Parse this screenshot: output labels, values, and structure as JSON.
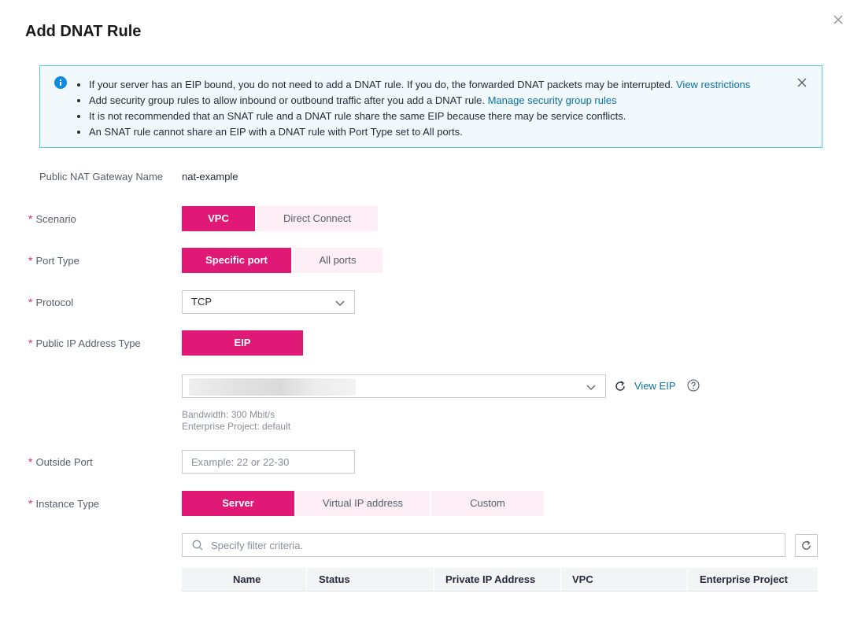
{
  "dialog": {
    "title": "Add DNAT Rule",
    "close_icon": "close-icon"
  },
  "notice": {
    "icon": "info-icon",
    "items": [
      {
        "text": "If your server has an EIP bound, you do not need to add a DNAT rule. If you do, the forwarded DNAT packets may be interrupted. ",
        "link": "View restrictions"
      },
      {
        "text": "Add security group rules to allow inbound or outbound traffic after you add a DNAT rule. ",
        "link": "Manage security group rules"
      },
      {
        "text": "It is not recommended that an SNAT rule and a DNAT rule share the same EIP because there may be service conflicts.",
        "link": ""
      },
      {
        "text": "An SNAT rule cannot share an EIP with a DNAT rule with Port Type set to All ports.",
        "link": ""
      }
    ]
  },
  "form": {
    "required_mark": "*",
    "gateway": {
      "label": "Public NAT Gateway Name",
      "value": "nat-example"
    },
    "scenario": {
      "label": "Scenario",
      "options": [
        "VPC",
        "Direct Connect"
      ],
      "selected": "VPC"
    },
    "port_type": {
      "label": "Port Type",
      "options": [
        "Specific port",
        "All ports"
      ],
      "selected": "Specific port"
    },
    "protocol": {
      "label": "Protocol",
      "value": "TCP"
    },
    "public_ip_type": {
      "label": "Public IP Address Type",
      "options": [
        "EIP"
      ],
      "selected": "EIP"
    },
    "eip": {
      "value_hidden": true,
      "view_link": "View EIP",
      "bandwidth": "Bandwidth: 300 Mbit/s",
      "enterprise_project": "Enterprise Project: default"
    },
    "outside_port": {
      "label": "Outside Port",
      "placeholder": "Example: 22 or 22-30"
    },
    "instance_type": {
      "label": "Instance Type",
      "options": [
        "Server",
        "Virtual IP address",
        "Custom"
      ],
      "selected": "Server"
    },
    "filter": {
      "placeholder": "Specify filter criteria."
    },
    "table": {
      "columns": [
        "Name",
        "Status",
        "Private IP Address",
        "VPC",
        "Enterprise Project"
      ]
    }
  },
  "colors": {
    "accent": "#e01876",
    "accent_light": "#fdeff5",
    "link": "#0a6fa8",
    "notice_bg": "#f1f9fd",
    "notice_border": "#5cc8dc"
  }
}
